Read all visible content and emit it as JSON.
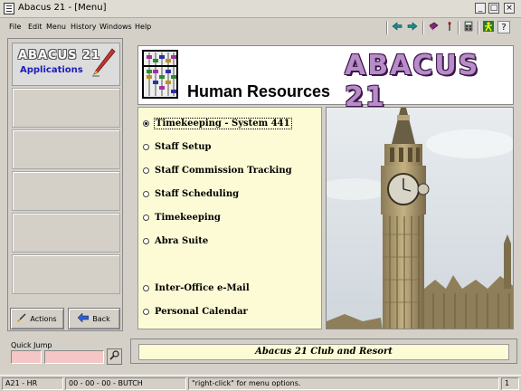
{
  "window": {
    "title": "Abacus 21 - [Menu]"
  },
  "menubar": {
    "items": [
      "File",
      "Edit",
      "Menu",
      "History",
      "Windows",
      "Help"
    ]
  },
  "toolbar": {
    "icons": [
      "back-arrow-icon",
      "forward-arrow-icon",
      "book-icon",
      "bell-icon",
      "calculator-icon",
      "person-icon",
      "help-question-icon"
    ],
    "help_glyph": "?"
  },
  "left_panel": {
    "logo_line1": "ABACUS 21",
    "logo_line2": "Applications",
    "actions_label": "Actions",
    "back_label": "Back"
  },
  "quick_jump": {
    "label": "Quick Jump"
  },
  "header": {
    "module_title": "Human Resources",
    "brand": "ABACUS 21"
  },
  "options": [
    {
      "label": "Timekeeping - System 441",
      "selected": true
    },
    {
      "label": "Staff Setup",
      "selected": false
    },
    {
      "label": "Staff Commission Tracking",
      "selected": false
    },
    {
      "label": "Staff Scheduling",
      "selected": false
    },
    {
      "label": "Timekeeping",
      "selected": false
    },
    {
      "label": "Abra Suite",
      "selected": false
    },
    {
      "label": "Inter-Office e-Mail",
      "selected": false
    },
    {
      "label": "Personal Calendar",
      "selected": false
    }
  ],
  "footer": {
    "company": "Abacus 21 Club and Resort"
  },
  "statusbar": {
    "module": "A21 - HR",
    "user": "00 - 00 - 00 - BUTCH",
    "hint": "\"right-click\" for menu options.",
    "page": "1"
  },
  "colors": {
    "option_bg": "#fdfbd6",
    "quick_jump_field": "#f5c6c6",
    "logo_blue": "#1d1db8",
    "brand_purple": "#b88cc8"
  }
}
